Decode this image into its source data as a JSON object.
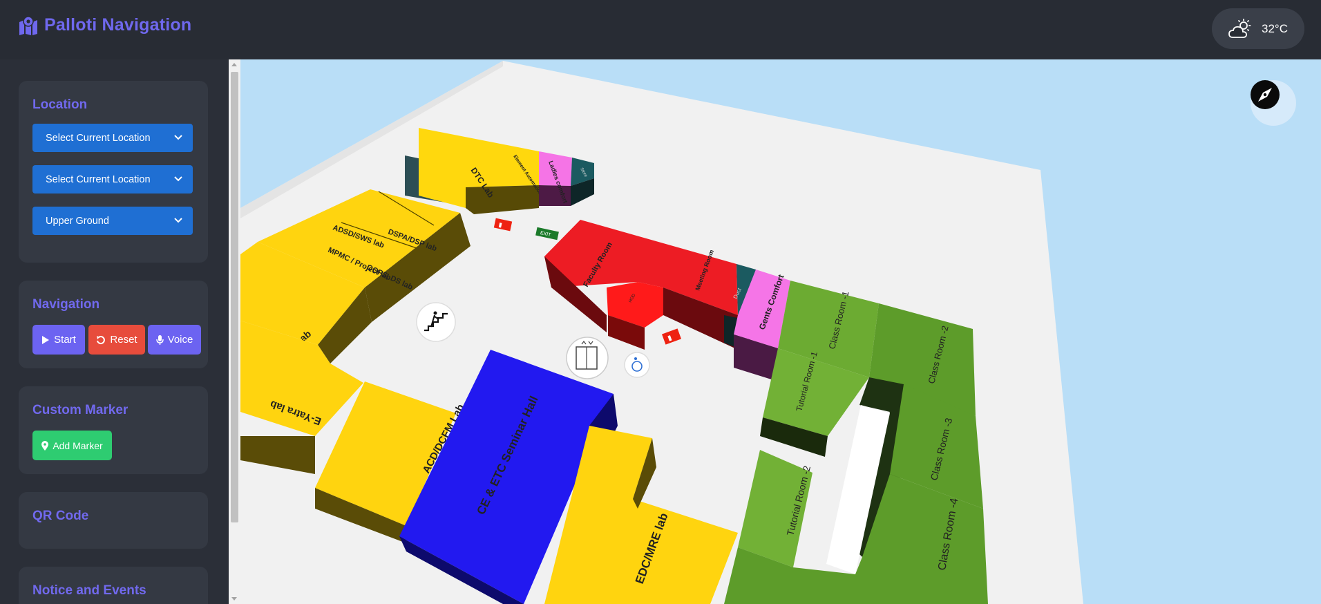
{
  "header": {
    "title": "Palloti Navigation",
    "brand_icon": "map-location-icon",
    "weather": {
      "icon": "cloud-sun-icon",
      "temperature": "32°C"
    }
  },
  "sidebar": {
    "location": {
      "title": "Location",
      "current_location": "Select Current Location",
      "destination": "Select Current Location",
      "floor": "Upper Ground"
    },
    "navigation": {
      "title": "Navigation",
      "start": "Start",
      "reset": "Reset",
      "voice": "Voice"
    },
    "custom_marker": {
      "title": "Custom Marker",
      "add_marker": "Add Marker"
    },
    "qr_code": {
      "title": "QR Code"
    },
    "notice": {
      "title": "Notice and Events"
    }
  },
  "map": {
    "compass_icon": "compass-icon",
    "rooms": {
      "dtc_lab": "DTC Lab",
      "element_lab": "Element Automation Lab",
      "ladies_comfort": "Ladies comfort",
      "store": "Store",
      "adsd_lab": "ADSD/SWS lab",
      "dspa_lab": "DSPA/DSP lab",
      "mpmc_lab": "MPMC / Project lab",
      "oops_lab": "OOPS, DS lab",
      "cd_dcom_lab": "CD/DCOM Lab",
      "e_yatra_lab": "E-Yatra lab",
      "acd_dcfm_lab": "ACD/DCFM Lab",
      "seminar_hall": "CE & ETC Seminar Hall",
      "edc_mre_lab": "EDC/MRE lab",
      "faculty_room": "Faculty Room",
      "hod": "HOD",
      "meeting_room": "Meeting Room",
      "duct": "Duct",
      "gents_comfort": "Gents Comfort",
      "class_room_1": "Class Room -1",
      "class_room_2": "Class Room -2",
      "class_room_3": "Class Room -3",
      "class_room_4": "Class Room -4",
      "tutorial_room_1": "Tutorial Room -1",
      "tutorial_room_2": "Tutorial Room -2",
      "exit_sign": "EXIT"
    },
    "colors": {
      "sky": "#b9def7",
      "floor": "#f2f2f2",
      "yellow": "#fed40a",
      "blue": "#2219f0",
      "red": "#ec1b24",
      "pink": "#f57de8",
      "teal": "#1b5a60",
      "green": "#6cab32"
    }
  }
}
